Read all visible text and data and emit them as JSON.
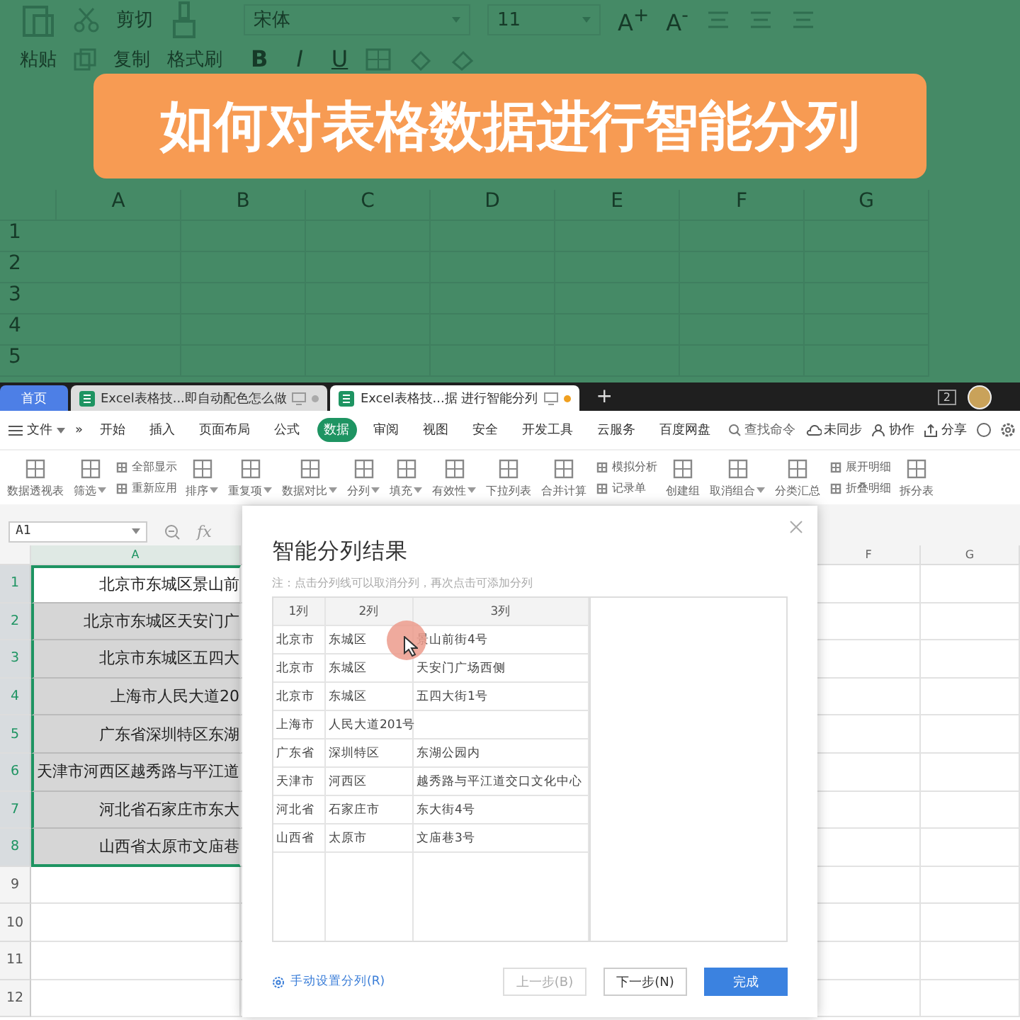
{
  "video_title": "如何对表格数据进行智能分列",
  "background_toolbar": {
    "row_1": [
      "剪切",
      "宋体",
      "11"
    ],
    "font_size_buttons": [
      "A$^{+}$",
      "A$^{-}$"
    ],
    "row_2": [
      "粘贴",
      "复制",
      "格式刷"
    ],
    "format_buttons": [
      "B",
      "I",
      "U"
    ]
  },
  "background_grid": {
    "columns": [
      "A",
      "B",
      "C",
      "D",
      "E",
      "F",
      "G"
    ],
    "rows": [
      "1",
      "2",
      "3",
      "4",
      "5"
    ]
  },
  "tabs": [
    {
      "label": "首页",
      "kind": "home",
      "selected": false
    },
    {
      "label": "Excel表格技...即自动配色怎么做",
      "kind": "doc",
      "selected": false,
      "modified": false
    },
    {
      "label": "Excel表格技...据 进行智能分列",
      "kind": "doc",
      "selected": true,
      "modified": true
    }
  ],
  "tab_add": "+",
  "user_count": "2",
  "menu": {
    "file": "文件",
    "more": "»",
    "tabs": [
      {
        "label": "开始",
        "selected": false
      },
      {
        "label": "插入",
        "selected": false
      },
      {
        "label": "页面布局",
        "selected": false
      },
      {
        "label": "公式",
        "selected": false
      },
      {
        "label": "数据",
        "selected": true
      },
      {
        "label": "审阅",
        "selected": false
      },
      {
        "label": "视图",
        "selected": false
      },
      {
        "label": "安全",
        "selected": false
      },
      {
        "label": "开发工具",
        "selected": false
      },
      {
        "label": "云服务",
        "selected": false
      },
      {
        "label": "百度网盘",
        "selected": false
      }
    ],
    "search": {
      "placeholder": "查找命令"
    },
    "actions": [
      "未同步",
      "协作",
      "分享"
    ]
  },
  "ribbon": [
    {
      "kind": "large",
      "label": "数据透视表",
      "dropdown": false
    },
    {
      "kind": "large",
      "label": "筛选",
      "dropdown": true
    },
    {
      "kind": "pair",
      "items": [
        "全部显示",
        "重新应用"
      ]
    },
    {
      "kind": "large",
      "label": "排序",
      "dropdown": true
    },
    {
      "kind": "large",
      "label": "重复项",
      "dropdown": true
    },
    {
      "kind": "large",
      "label": "数据对比",
      "dropdown": true
    },
    {
      "kind": "large",
      "label": "分列",
      "dropdown": true
    },
    {
      "kind": "large",
      "label": "填充",
      "dropdown": true
    },
    {
      "kind": "large",
      "label": "有效性",
      "dropdown": true
    },
    {
      "kind": "large",
      "label": "下拉列表",
      "dropdown": false
    },
    {
      "kind": "large",
      "label": "合并计算",
      "dropdown": false
    },
    {
      "kind": "pair",
      "items": [
        "模拟分析",
        "记录单"
      ]
    },
    {
      "kind": "large",
      "label": "创建组",
      "dropdown": false
    },
    {
      "kind": "large",
      "label": "取消组合",
      "dropdown": true
    },
    {
      "kind": "large",
      "label": "分类汇总",
      "dropdown": false
    },
    {
      "kind": "pair",
      "items": [
        "展开明细",
        "折叠明细"
      ]
    },
    {
      "kind": "large",
      "label": "拆分表",
      "dropdown": false
    }
  ],
  "formula_bar": {
    "cell_ref": "A1",
    "fx": "fx"
  },
  "sheet": {
    "columns": [
      "A",
      "F",
      "G"
    ],
    "rows": [
      {
        "number": "1",
        "cell_a": "北京市东城区景山前",
        "selected": true,
        "active": true
      },
      {
        "number": "2",
        "cell_a": "北京市东城区天安门广",
        "selected": true,
        "active": false
      },
      {
        "number": "3",
        "cell_a": "北京市东城区五四大",
        "selected": true,
        "active": false
      },
      {
        "number": "4",
        "cell_a": "上海市人民大道20",
        "selected": true,
        "active": false
      },
      {
        "number": "5",
        "cell_a": "广东省深圳特区东湖",
        "selected": true,
        "active": false
      },
      {
        "number": "6",
        "cell_a": "天津市河西区越秀路与平江道",
        "selected": true,
        "active": false
      },
      {
        "number": "7",
        "cell_a": "河北省石家庄市东大",
        "selected": true,
        "active": false
      },
      {
        "number": "8",
        "cell_a": "山西省太原市文庙巷",
        "selected": true,
        "active": false
      },
      {
        "number": "9",
        "selected": false,
        "active": false
      },
      {
        "number": "10",
        "selected": false,
        "active": false
      },
      {
        "number": "11",
        "selected": false,
        "active": false
      },
      {
        "number": "12",
        "selected": false,
        "active": false
      }
    ]
  },
  "dialog": {
    "title": "智能分列结果",
    "note": "注：点击分列线可以取消分列，再次点击可添加分列",
    "columns": [
      "1列",
      "2列",
      "3列"
    ],
    "rows": [
      [
        "北京市",
        "东城区",
        "景山前街4号"
      ],
      [
        "北京市",
        "东城区",
        "天安门广场西侧"
      ],
      [
        "北京市",
        "东城区",
        "五四大街1号"
      ],
      [
        "上海市",
        "人民大道201号"
      ],
      [
        "广东省",
        "深圳特区",
        "东湖公园内"
      ],
      [
        "天津市",
        "河西区",
        "越秀路与平江道交口文化中心"
      ],
      [
        "河北省",
        "石家庄市",
        "东大街4号"
      ],
      [
        "山西省",
        "太原市",
        "文庙巷3号"
      ]
    ],
    "manual_link": "手动设置分列(R)",
    "buttons": [
      {
        "label": "上一步(B)",
        "kind": "secondary",
        "disabled": true
      },
      {
        "label": "下一步(N)",
        "kind": "secondary",
        "disabled": false
      },
      {
        "label": "完成",
        "kind": "primary",
        "disabled": false
      }
    ]
  }
}
